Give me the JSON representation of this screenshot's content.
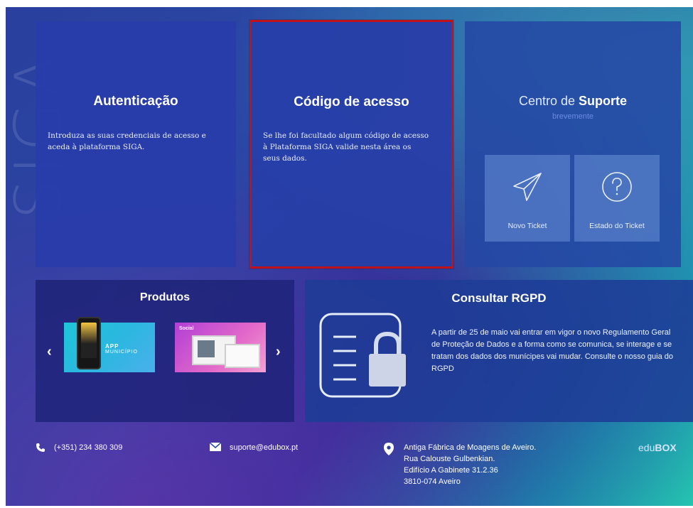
{
  "auth": {
    "title": "Autenticação",
    "text": "Introduza as suas credenciais de acesso e aceda à plataforma SIGA."
  },
  "access_code": {
    "title": "Código de acesso",
    "text": "Se lhe foi facultado algum código de acesso à Plataforma SIGA valide nesta área os seus dados.",
    "highlight_color": "#c0121b"
  },
  "support": {
    "title_prefix": "Centro de ",
    "title_bold": "Suporte",
    "subtitle": "brevemente",
    "tickets": [
      {
        "label": "Novo Ticket",
        "icon": "paper-plane-icon"
      },
      {
        "label": "Estado do Ticket",
        "icon": "question-circle-icon"
      }
    ]
  },
  "products": {
    "title": "Produtos",
    "items": [
      {
        "name": "APP",
        "subtitle": "MUNICÍPIO"
      },
      {
        "name": "Social"
      }
    ],
    "prev_icon": "chevron-left-icon",
    "next_icon": "chevron-right-icon"
  },
  "rgpd": {
    "title": "Consultar RGPD",
    "text": "A partir de 25 de maio vai entrar em vigor o novo Regulamento Geral de Proteção de Dados e a forma como se comunica, se interage e se tratam dos dados dos munícipes vai mudar. Consulte o nosso guia do RGPD",
    "icon": "id-card-lock-icon"
  },
  "footer": {
    "phone": "(+351) 234 380 309",
    "email": "suporte@edubox.pt",
    "address": [
      "Antiga Fábrica de Moagens de Aveiro.",
      "Rua Calouste Gulbenkian.",
      "Edifício A Gabinete 31.2.36",
      "3810-074 Aveiro"
    ],
    "logo_prefix": "edu",
    "logo_bold": "BOX"
  }
}
